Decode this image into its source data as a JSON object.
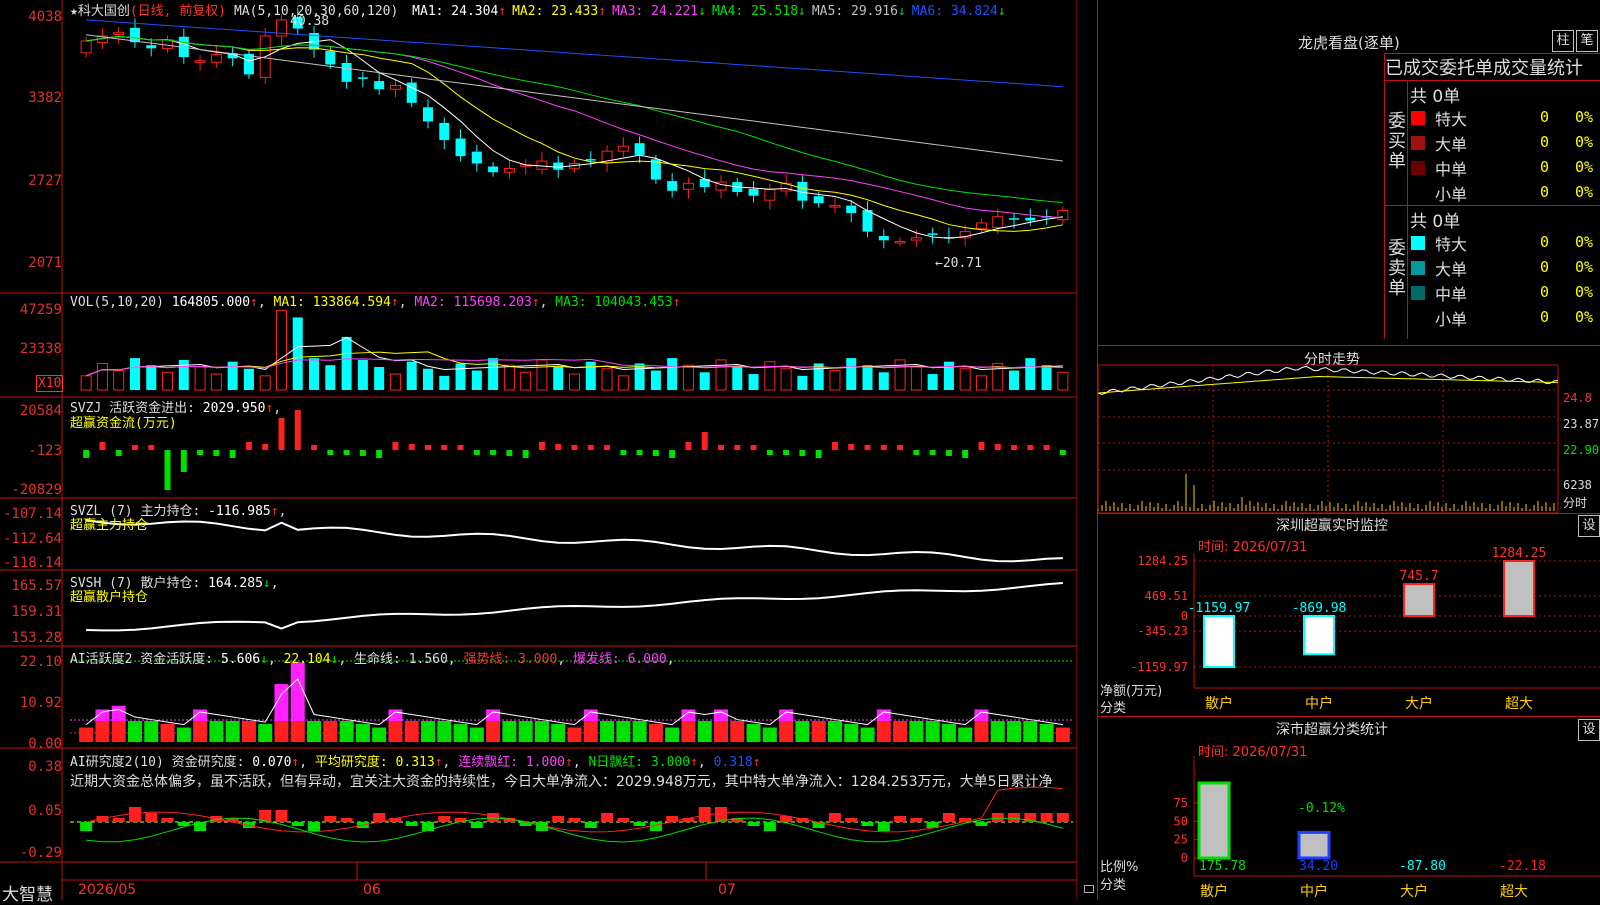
{
  "stock": {
    "name": "★科大国创",
    "mode": "(日线, 前复权)"
  },
  "price_panel": {
    "ma_label": "MA(5,10,20,30,60,120)",
    "ma": [
      {
        "label": "MA1:",
        "value": "24.304",
        "arrow": "↑",
        "color": "#ffffff"
      },
      {
        "label": "MA2:",
        "value": "23.433",
        "arrow": "↑",
        "color": "#ffff00"
      },
      {
        "label": "MA3:",
        "value": "24.221",
        "arrow": "↓",
        "color": "#ff40ff"
      },
      {
        "label": "MA4:",
        "value": "25.518",
        "arrow": "↓",
        "color": "#00e000"
      },
      {
        "label": "MA5:",
        "value": "29.916",
        "arrow": "↓",
        "color": "#c0c0c0"
      },
      {
        "label": "MA6:",
        "value": "34.824",
        "arrow": "↓",
        "color": "#2050ff"
      }
    ],
    "y_ticks": [
      "4038",
      "3382",
      "2727",
      "2071"
    ],
    "high_mark": "40.38",
    "low_mark": "←20.71"
  },
  "vol_panel": {
    "label": "VOL(5,10,20)",
    "value": "164805.000",
    "ma1": "MA1: 133864.594",
    "ma2": "MA2: 115698.203",
    "ma3": "MA3: 104043.453",
    "y_ticks": [
      "47259",
      "23338"
    ],
    "unit": "X10"
  },
  "svzj_panel": {
    "label": "SVZJ  活跃资金进出:",
    "value": "2029.950",
    "sub": "超赢资金流(万元)",
    "y_ticks": [
      "20584",
      "-123",
      "-20829"
    ]
  },
  "svzl_panel": {
    "label": "SVZL (7) 主力持仓:",
    "value": "-116.985",
    "sub": "超赢主力持仓",
    "y_ticks": [
      "-107.14",
      "-112.64",
      "-118.14"
    ]
  },
  "svsh_panel": {
    "label": "SVSH (7) 散户持仓:",
    "value": "164.285",
    "sub": "超赢散户持仓",
    "y_ticks": [
      "165.57",
      "159.31",
      "153.28"
    ]
  },
  "ai_panel": {
    "label": "AI活跃度2 资金活跃度:",
    "v1": "5.606",
    "v2": "22.104",
    "life": "生命线: 1.560",
    "strong": "强势线: 3.000",
    "burst": "爆发线: 6.000",
    "y_ticks": [
      "22.10",
      "10.92",
      "0.00"
    ]
  },
  "research_panel": {
    "label": "AI研究度2(10) 资金研究度:",
    "v1": "0.070",
    "avg": "平均研究度: 0.313",
    "cont": "连续飘红: 1.000",
    "nday": "N日飘红: 3.000",
    "v5": "0.318",
    "comment": "近期大资金总体偏多，虽不活跃，但有异动，宜关注大资金的持续性，今日大单净流入：2029.948万元，其中特大单净流入：1284.253万元，大单5日累计净",
    "y_ticks": [
      "0.38",
      "0.05",
      "-0.29"
    ]
  },
  "x_axis": {
    "labels": [
      "2026/05",
      "06",
      "07"
    ],
    "brand": "大智慧"
  },
  "dragon": {
    "title": "龙虎看盘(逐单)",
    "btn1": "柱",
    "btn2": "笔",
    "subtitle": "已成交委托单成交量统计",
    "buy_label": "委买单",
    "sell_label": "委卖单",
    "buy_total": "共 0单",
    "sell_total": "共 0单",
    "buy_rows": [
      {
        "name": "特大",
        "count": "0",
        "pct": "0%",
        "color": "#ff0000"
      },
      {
        "name": "大单",
        "count": "0",
        "pct": "0%",
        "color": "#a01010"
      },
      {
        "name": "中单",
        "count": "0",
        "pct": "0%",
        "color": "#6a0000"
      },
      {
        "name": "小单",
        "count": "0",
        "pct": "0%",
        "color": ""
      }
    ],
    "sell_rows": [
      {
        "name": "特大",
        "count": "0",
        "pct": "0%",
        "color": "#00ffff"
      },
      {
        "name": "大单",
        "count": "0",
        "pct": "0%",
        "color": "#009a9a"
      },
      {
        "name": "中单",
        "count": "0",
        "pct": "0%",
        "color": "#006a6a"
      },
      {
        "name": "小单",
        "count": "0",
        "pct": "0%",
        "color": ""
      }
    ]
  },
  "intraday": {
    "title": "分时走势",
    "y_ticks": [
      "24.8",
      "23.87",
      "22.90"
    ],
    "vol_tick": "6238",
    "vol_unit": "分时"
  },
  "sz_monitor": {
    "title": "深圳超赢实时监控",
    "btn": "设",
    "time": "时间: 2026/07/31",
    "y_ticks": [
      "1284.25",
      "469.51",
      "0",
      "-345.23",
      "-1159.97"
    ],
    "ylabel": "净额(万元)",
    "xlabel": "分类",
    "categories": [
      "散户",
      "中户",
      "大户",
      "超大"
    ],
    "values": [
      -1159.97,
      -869.98,
      745.7,
      1284.25
    ],
    "value_labels": [
      "-1159.97",
      "-869.98",
      "745.7",
      "1284.25"
    ]
  },
  "sz_stats": {
    "title": "深市超赢分类统计",
    "btn": "设",
    "time": "时间: 2026/07/31",
    "y_ticks": [
      "75",
      "50",
      "25",
      "0"
    ],
    "ylabel": "比例%",
    "xlabel": "分类",
    "categories": [
      "散户",
      "中户",
      "大户",
      "超大"
    ],
    "values": [
      175.78,
      34.2,
      -87.8,
      -22.18
    ],
    "value_labels": [
      "175.78",
      "34.20",
      "-87.80",
      "-22.18"
    ],
    "extra_label": "-0.12%"
  },
  "chart_data": {
    "type": "candlestick",
    "title": "科大国创 (日线, 前复权)",
    "x_labels": [
      "2026/05",
      "06",
      "07"
    ],
    "price_range": [
      20.71,
      40.38
    ],
    "ohlc_closes": [
      38.5,
      38.9,
      39.2,
      38.4,
      37.9,
      38.6,
      37.2,
      36.9,
      37.4,
      37.1,
      35.8,
      38.9,
      40.2,
      39.5,
      37.8,
      36.6,
      35.2,
      35.5,
      34.6,
      34.9,
      33.5,
      32.0,
      30.5,
      29.2,
      28.6,
      27.9,
      28.2,
      28.5,
      28.8,
      28.1,
      28.6,
      28.9,
      29.6,
      30.0,
      29.3,
      27.3,
      26.4,
      27.0,
      26.7,
      27.1,
      26.3,
      26.0,
      26.5,
      27.0,
      25.6,
      25.4,
      25.2,
      24.6,
      23.1,
      22.4,
      22.3,
      22.6,
      22.9,
      22.6,
      23.1,
      23.8,
      24.3,
      24.1,
      24.0,
      24.3,
      24.8
    ]
  }
}
